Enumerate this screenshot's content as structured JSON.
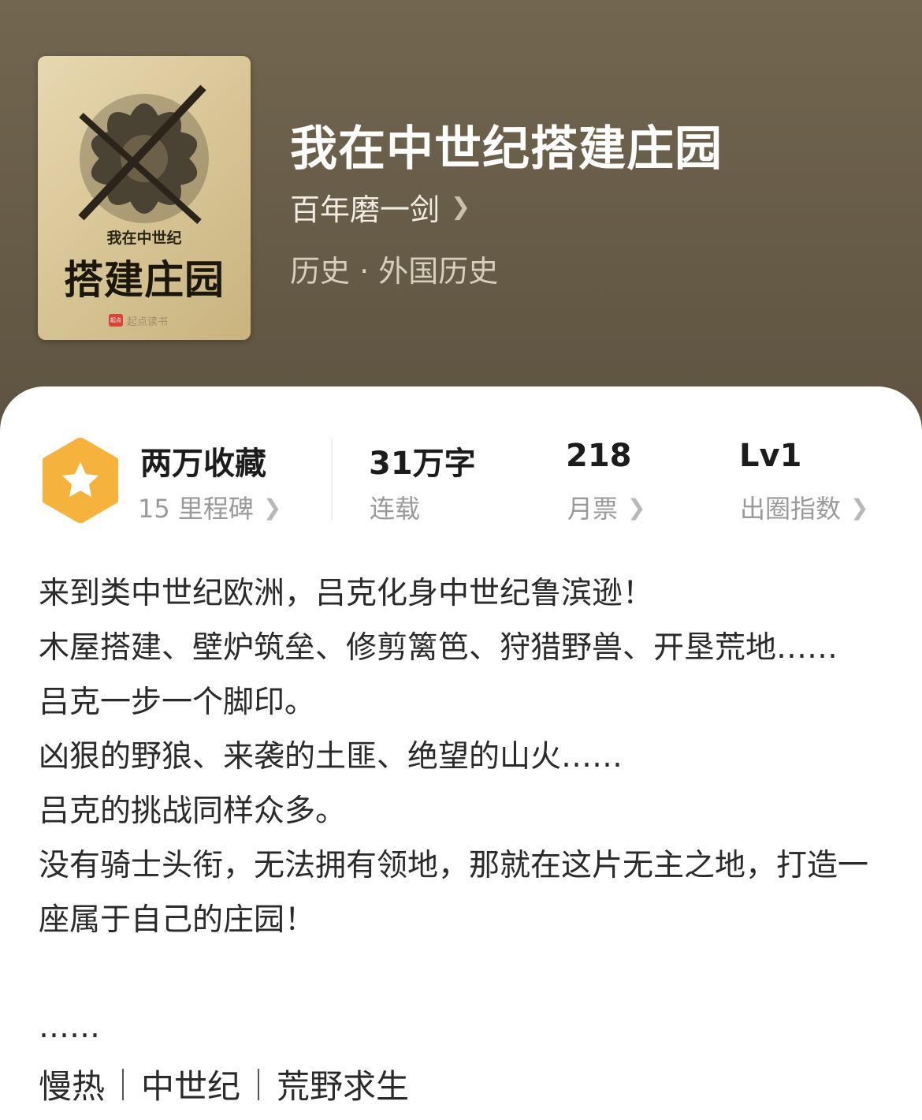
{
  "book": {
    "title": "我在中世纪搭建庄园",
    "author": "百年磨一剑",
    "category": "历史 · 外国历史"
  },
  "cover": {
    "subtitle": "我在中世纪",
    "title": "搭建庄园",
    "publisher": "起点读书",
    "publisher_badge": "起点"
  },
  "stats": {
    "favorites": {
      "main": "两万收藏",
      "sub": "15 里程碑"
    },
    "words": {
      "main": "31万字",
      "sub": "连载"
    },
    "monthly_tickets": {
      "main": "218",
      "sub": "月票"
    },
    "level": {
      "main": "Lv1",
      "sub": "出圈指数"
    }
  },
  "description": [
    "来到类中世纪欧洲，吕克化身中世纪鲁滨逊！",
    "木屋搭建、壁炉筑垒、修剪篱笆、狩猎野兽、开垦荒地……",
    "吕克一步一个脚印。",
    "凶狠的野狼、来袭的土匪、绝望的山火……",
    "吕克的挑战同样众多。",
    "没有骑士头衔，无法拥有领地，那就在这片无主之地，打造一座属于自己的庄园！"
  ],
  "description_ellipsis": "……",
  "tags": [
    "慢热",
    "中世纪",
    "荒野求生"
  ],
  "colors": {
    "header_bg": "#6a5e49",
    "badge_orange": "#f5b33d",
    "text_main": "#1c1c1c",
    "text_muted": "#9a9a9a"
  },
  "icons": {
    "favorite_badge": "star-hexagon-icon",
    "chevron": "chevron-right-icon"
  }
}
